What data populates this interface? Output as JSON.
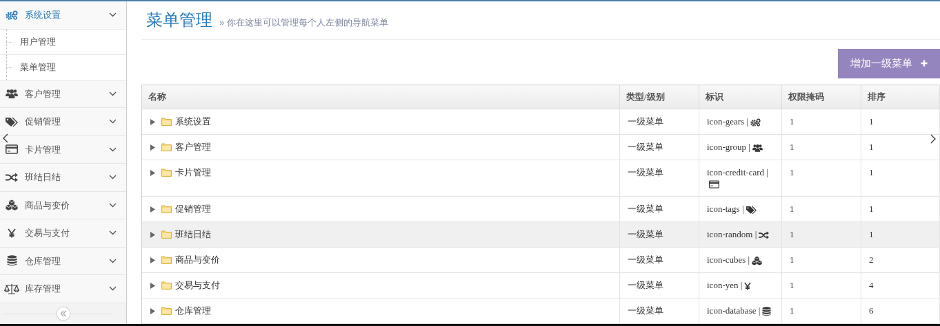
{
  "sidebar": {
    "items": [
      {
        "label": "系统设置",
        "expanded": true,
        "children": [
          {
            "label": "用户管理"
          },
          {
            "label": "菜单管理"
          }
        ]
      },
      {
        "label": "客户管理",
        "expanded": false
      },
      {
        "label": "促销管理",
        "expanded": false
      },
      {
        "label": "卡片管理",
        "expanded": false
      },
      {
        "label": "班结日结",
        "expanded": false
      },
      {
        "label": "商品与变价",
        "expanded": false
      },
      {
        "label": "交易与支付",
        "expanded": false
      },
      {
        "label": "仓库管理",
        "expanded": false
      },
      {
        "label": "库存管理",
        "expanded": false
      }
    ]
  },
  "page_header": {
    "title": "菜单管理",
    "subtitle": "» 你在这里可以管理每个人左侧的导航菜单"
  },
  "add_button": {
    "label": "增加一级菜单"
  },
  "table": {
    "columns": [
      "名称",
      "类型/级别",
      "标识",
      "权限掩码",
      "排序"
    ],
    "rows": [
      {
        "name": "系统设置",
        "type": "一级菜单",
        "mark": "icon-gears |",
        "mask": "1",
        "order": "1",
        "expanded": false,
        "hovered": false
      },
      {
        "name": "客户管理",
        "type": "一级菜单",
        "mark": "icon-group |",
        "mask": "1",
        "order": "1",
        "expanded": false,
        "hovered": false
      },
      {
        "name": "卡片管理",
        "type": "一级菜单",
        "mark": "icon-credit-card |",
        "mask": "1",
        "order": "1",
        "expanded": false,
        "hovered": false
      },
      {
        "name": "促销管理",
        "type": "一级菜单",
        "mark": "icon-tags |",
        "mask": "1",
        "order": "1",
        "expanded": false,
        "hovered": false
      },
      {
        "name": "班结日结",
        "type": "一级菜单",
        "mark": "icon-random |",
        "mask": "1",
        "order": "1",
        "expanded": false,
        "hovered": true
      },
      {
        "name": "商品与变价",
        "type": "一级菜单",
        "mark": "icon-cubes |",
        "mask": "1",
        "order": "2",
        "expanded": false,
        "hovered": false
      },
      {
        "name": "交易与支付",
        "type": "一级菜单",
        "mark": "icon-yen |",
        "mask": "1",
        "order": "4",
        "expanded": false,
        "hovered": false
      },
      {
        "name": "仓库管理",
        "type": "一级菜单",
        "mark": "icon-database |",
        "mask": "1",
        "order": "6",
        "expanded": false,
        "hovered": false
      }
    ]
  }
}
